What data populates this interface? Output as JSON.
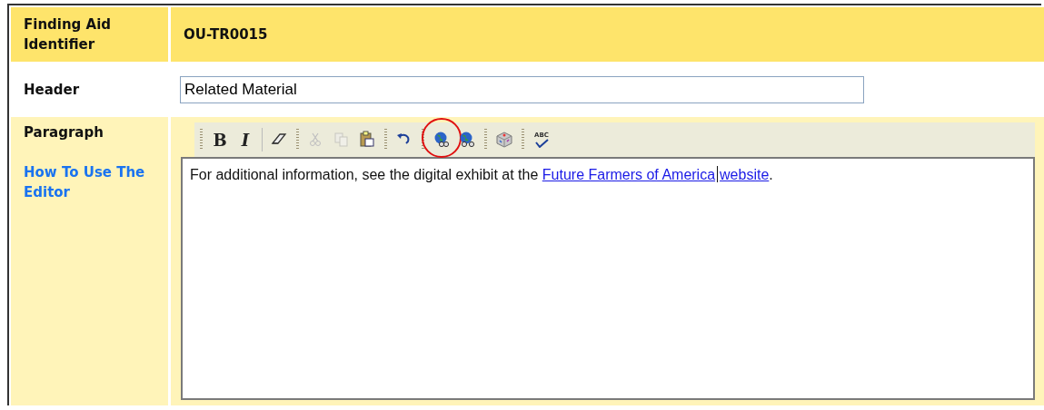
{
  "identifier": {
    "label": "Finding Aid Identifier",
    "value": "OU-TR0015"
  },
  "header": {
    "label": "Header",
    "value": "Related Material"
  },
  "paragraph": {
    "label": "Paragraph",
    "help_link": "How To Use The Editor",
    "toolbar": [
      {
        "kind": "grip"
      },
      {
        "kind": "bold",
        "label": "B",
        "disabled": false
      },
      {
        "kind": "italic",
        "label": "I",
        "disabled": false
      },
      {
        "kind": "separator"
      },
      {
        "kind": "eraser",
        "disabled": false
      },
      {
        "kind": "grip"
      },
      {
        "kind": "cut",
        "disabled": true
      },
      {
        "kind": "copy",
        "disabled": true
      },
      {
        "kind": "paste",
        "disabled": false
      },
      {
        "kind": "grip"
      },
      {
        "kind": "undo",
        "disabled": false
      },
      {
        "kind": "grip"
      },
      {
        "kind": "link",
        "disabled": false,
        "highlighted": true
      },
      {
        "kind": "unlink",
        "disabled": false
      },
      {
        "kind": "grip"
      },
      {
        "kind": "cube",
        "disabled": false
      },
      {
        "kind": "grip"
      },
      {
        "kind": "spell",
        "label": "ABC",
        "disabled": false
      }
    ],
    "content": {
      "before": "For additional information, see the digital exhibit at the ",
      "link_1": "Future Farmers of America",
      "link_2": "website",
      "after": "."
    }
  }
}
